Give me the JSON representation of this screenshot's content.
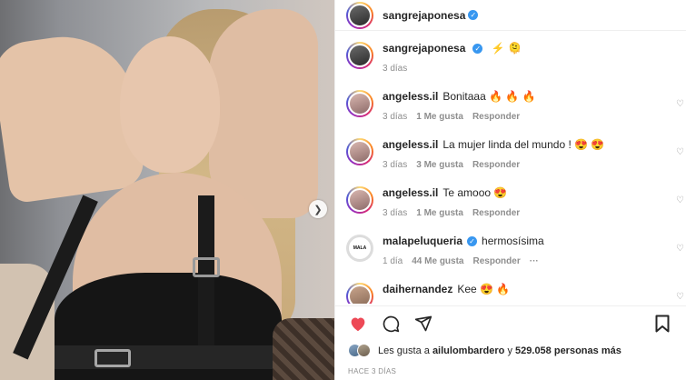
{
  "post": {
    "author": "sangrejaponesa",
    "caption_emoji": "⚡ 🫠",
    "caption_time": "3 días"
  },
  "comments": [
    {
      "user": "angeless.il",
      "text": "Bonitaaa 🔥 🔥 🔥",
      "time": "3 días",
      "likes": "1 Me gusta",
      "reply": "Responder",
      "more": ""
    },
    {
      "user": "angeless.il",
      "text": "La mujer linda del mundo ! 😍 😍",
      "time": "3 días",
      "likes": "3 Me gusta",
      "reply": "Responder",
      "more": ""
    },
    {
      "user": "angeless.il",
      "text": "Te amooo 😍",
      "time": "3 días",
      "likes": "1 Me gusta",
      "reply": "Responder",
      "more": ""
    },
    {
      "user": "malapeluqueria",
      "text": "hermosísima",
      "time": "1 día",
      "likes": "44 Me gusta",
      "reply": "Responder",
      "more": "···",
      "avatar_text": "MALA"
    },
    {
      "user": "daihernandez",
      "text": "Kee 😍 🔥",
      "time": "",
      "likes": "",
      "reply": "",
      "more": ""
    }
  ],
  "likes": {
    "prefix": "Les gusta a",
    "user": "ailulombardero",
    "joiner": "y",
    "count": "529.058 personas más"
  },
  "date": "HACE 3 DÍAS",
  "icons": {
    "like": "heart-filled-icon",
    "comment": "comment-icon",
    "share": "share-icon",
    "save": "bookmark-icon",
    "next": "chevron-right-icon",
    "verified": "verified-badge-icon"
  },
  "colors": {
    "like_red": "#ed4956",
    "verified_blue": "#3897f0",
    "muted": "#8e8e8e"
  }
}
